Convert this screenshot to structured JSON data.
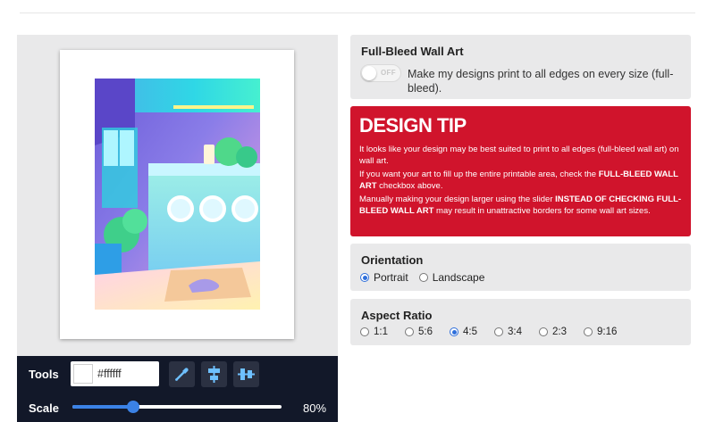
{
  "tools": {
    "label": "Tools",
    "color_value": "#ffffff"
  },
  "scale": {
    "label": "Scale",
    "value_text": "80%",
    "fraction": 0.29
  },
  "full_bleed": {
    "title": "Full-Bleed Wall Art",
    "toggle_text": "OFF",
    "description": "Make my designs print to all edges on every size (full-bleed)."
  },
  "design_tip": {
    "title": "DESIGN TIP",
    "p1": "It looks like your design may be best suited to print to all edges (full-bleed wall art) on wall art.",
    "p2_a": "If you want your art to fill up the entire printable area, check the ",
    "p2_b": "FULL-BLEED WALL ART",
    "p2_c": " checkbox above.",
    "p3_a": "Manually making your design larger using the slider ",
    "p3_b": "INSTEAD OF CHECKING FULL-BLEED WALL ART",
    "p3_c": " may result in unattractive borders for some wall art sizes."
  },
  "orientation": {
    "title": "Orientation",
    "options": [
      "Portrait",
      "Landscape"
    ],
    "selected": "Portrait"
  },
  "aspect_ratio": {
    "title": "Aspect Ratio",
    "options": [
      "1:1",
      "5:6",
      "4:5",
      "3:4",
      "2:3",
      "9:16"
    ],
    "selected": "4:5"
  },
  "colors": {
    "tip_red": "#d0142c",
    "toolbar_dark": "#121829",
    "accent_blue": "#3b82e6"
  },
  "icons": {
    "eyedropper": "eyedropper-icon",
    "align_vertical": "align-vertical-center-icon",
    "align_horizontal": "align-horizontal-center-icon"
  }
}
